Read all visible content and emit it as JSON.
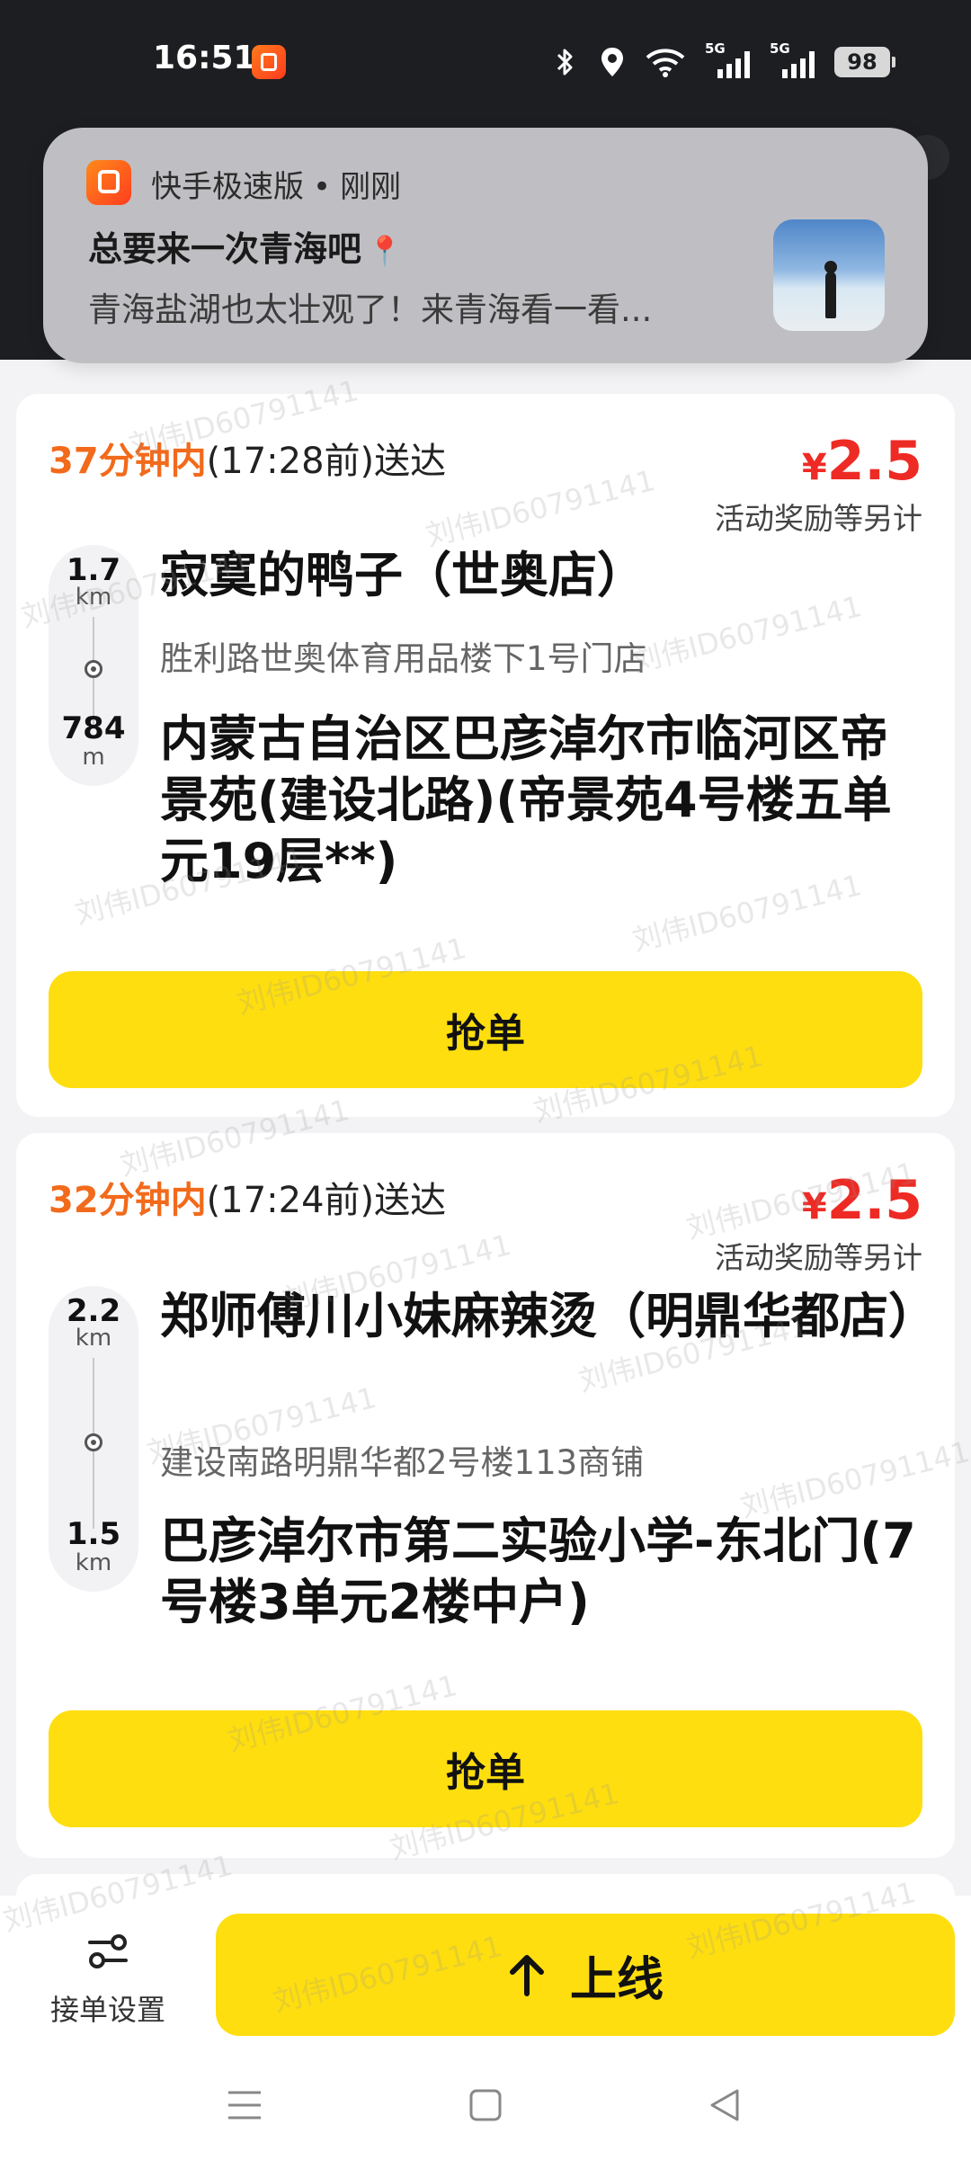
{
  "status_bar": {
    "time": "16:51",
    "net1": "5G",
    "net2": "5G",
    "battery": "98",
    "icons": [
      "app-notification-icon",
      "bluetooth-icon",
      "location-icon",
      "wifi-icon",
      "signal-5g-icon",
      "signal-5g-icon",
      "battery-icon"
    ]
  },
  "notification": {
    "app_name": "快手极速版",
    "separator": "•",
    "time": "刚刚",
    "title": "总要来一次青海吧",
    "title_emoji": "📍",
    "body": "青海盐湖也太壮观了！来青海看一看..."
  },
  "orders": [
    {
      "deliver_minutes": "37分钟内",
      "deliver_time": "(17:28前)送达",
      "price_symbol": "¥",
      "price": "2.5",
      "bonus_note": "活动奖励等另计",
      "pickup_distance": "1.7",
      "pickup_unit": "km",
      "drop_distance": "784",
      "drop_unit": "m",
      "shop_name": "寂寞的鸭子（世奥店）",
      "shop_address": "胜利路世奥体育用品楼下1号门店",
      "destination": "内蒙古自治区巴彦淖尔市临河区帝景苑(建设北路)(帝景苑4号楼五单元19层**)",
      "button_label": "抢单"
    },
    {
      "deliver_minutes": "32分钟内",
      "deliver_time": "(17:24前)送达",
      "price_symbol": "¥",
      "price": "2.5",
      "bonus_note": "活动奖励等另计",
      "pickup_distance": "2.2",
      "pickup_unit": "km",
      "drop_distance": "1.5",
      "drop_unit": "km",
      "shop_name": "郑师傅川小妹麻辣烫（明鼎华都店）",
      "shop_address": "建设南路明鼎华都2号楼113商铺",
      "destination": "巴彦淖尔市第二实验小学-东北门(7号楼3单元2楼中户)",
      "button_label": "抢单"
    }
  ],
  "bottom_bar": {
    "settings_label": "接单设置",
    "online_label": "上线"
  },
  "watermark": "刘伟ID60791141",
  "colors": {
    "accent_yellow": "#fede0f",
    "time_orange": "#f26a1b",
    "price_red": "#ee2a24",
    "status_bar_bg": "#1d1e22"
  }
}
